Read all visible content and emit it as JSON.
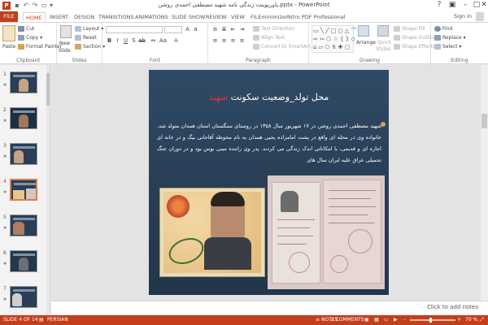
{
  "titlebar": {
    "doc_title": "پاورپوینت زندگی نامه شهید مصطفی احمدی روشن.pptx - PowerPoint",
    "app_icon": "P"
  },
  "tabs": [
    "FILE",
    "HOME",
    "INSERT",
    "DESIGN",
    "TRANSITIONS",
    "ANIMATIONS",
    "SLIDE SHOW",
    "REVIEW",
    "VIEW",
    "FILEminimizer",
    "Nitro PDF Professional"
  ],
  "active_tab": "HOME",
  "signin": "Sign in",
  "ribbon": {
    "clipboard": {
      "label": "Clipboard",
      "paste": "Paste",
      "cut": "Cut",
      "copy": "Copy",
      "format_painter": "Format Painter"
    },
    "slides": {
      "label": "Slides",
      "new_slide": "New",
      "new_slide2": "Slide",
      "layout": "Layout",
      "reset": "Reset",
      "section": "Section"
    },
    "font": {
      "label": "Font"
    },
    "paragraph": {
      "label": "Paragraph",
      "text_direction": "Text Direction",
      "align_text": "Align Text",
      "convert_smartart": "Convert to SmartArt"
    },
    "drawing": {
      "label": "Drawing",
      "arrange": "Arrange",
      "quick_styles": "Quick",
      "quick_styles2": "Styles",
      "shape_fill": "Shape Fill",
      "shape_outline": "Shape Outline",
      "shape_effects": "Shape Effects"
    },
    "editing": {
      "label": "Editing",
      "find": "Find",
      "replace": "Replace",
      "select": "Select"
    }
  },
  "slide_panel": {
    "items": [
      {
        "num": "1"
      },
      {
        "num": "2"
      },
      {
        "num": "3"
      },
      {
        "num": "4"
      },
      {
        "num": "5"
      },
      {
        "num": "6"
      },
      {
        "num": "7"
      }
    ],
    "selected": "4"
  },
  "slide": {
    "title_main": "محل تولد_وضعیت سکونت ",
    "title_red": "شهید",
    "body": "شهید مصطفی احمدی روشن در ۱۷ شهریور سال ۱۳۵۸ در روستای سنگستان استان همدان متولد شد. خانواده وی در محله ای واقع در پشت امامزاده یحیی همدان به نام محوطه آقاجانی بیگ و در خانه ای اجاره ای و قدیمی، با امکاناتی اندک زندگی می کردند. پدر وی راننده مینی بوس بود و در دوران جنگ تحمیلی عراق علیه ایران سال های"
  },
  "notes": {
    "placeholder": "Click to add notes"
  },
  "status": {
    "slide_of": "SLIDE 4 OF 14",
    "language": "PERSIAN",
    "notes": "NOTES",
    "comments": "COMMENTS",
    "zoom": "70 %"
  },
  "colors": {
    "accent": "#c43e1c",
    "slide_bg": "#2f4a66",
    "title_red": "#e2393a"
  }
}
